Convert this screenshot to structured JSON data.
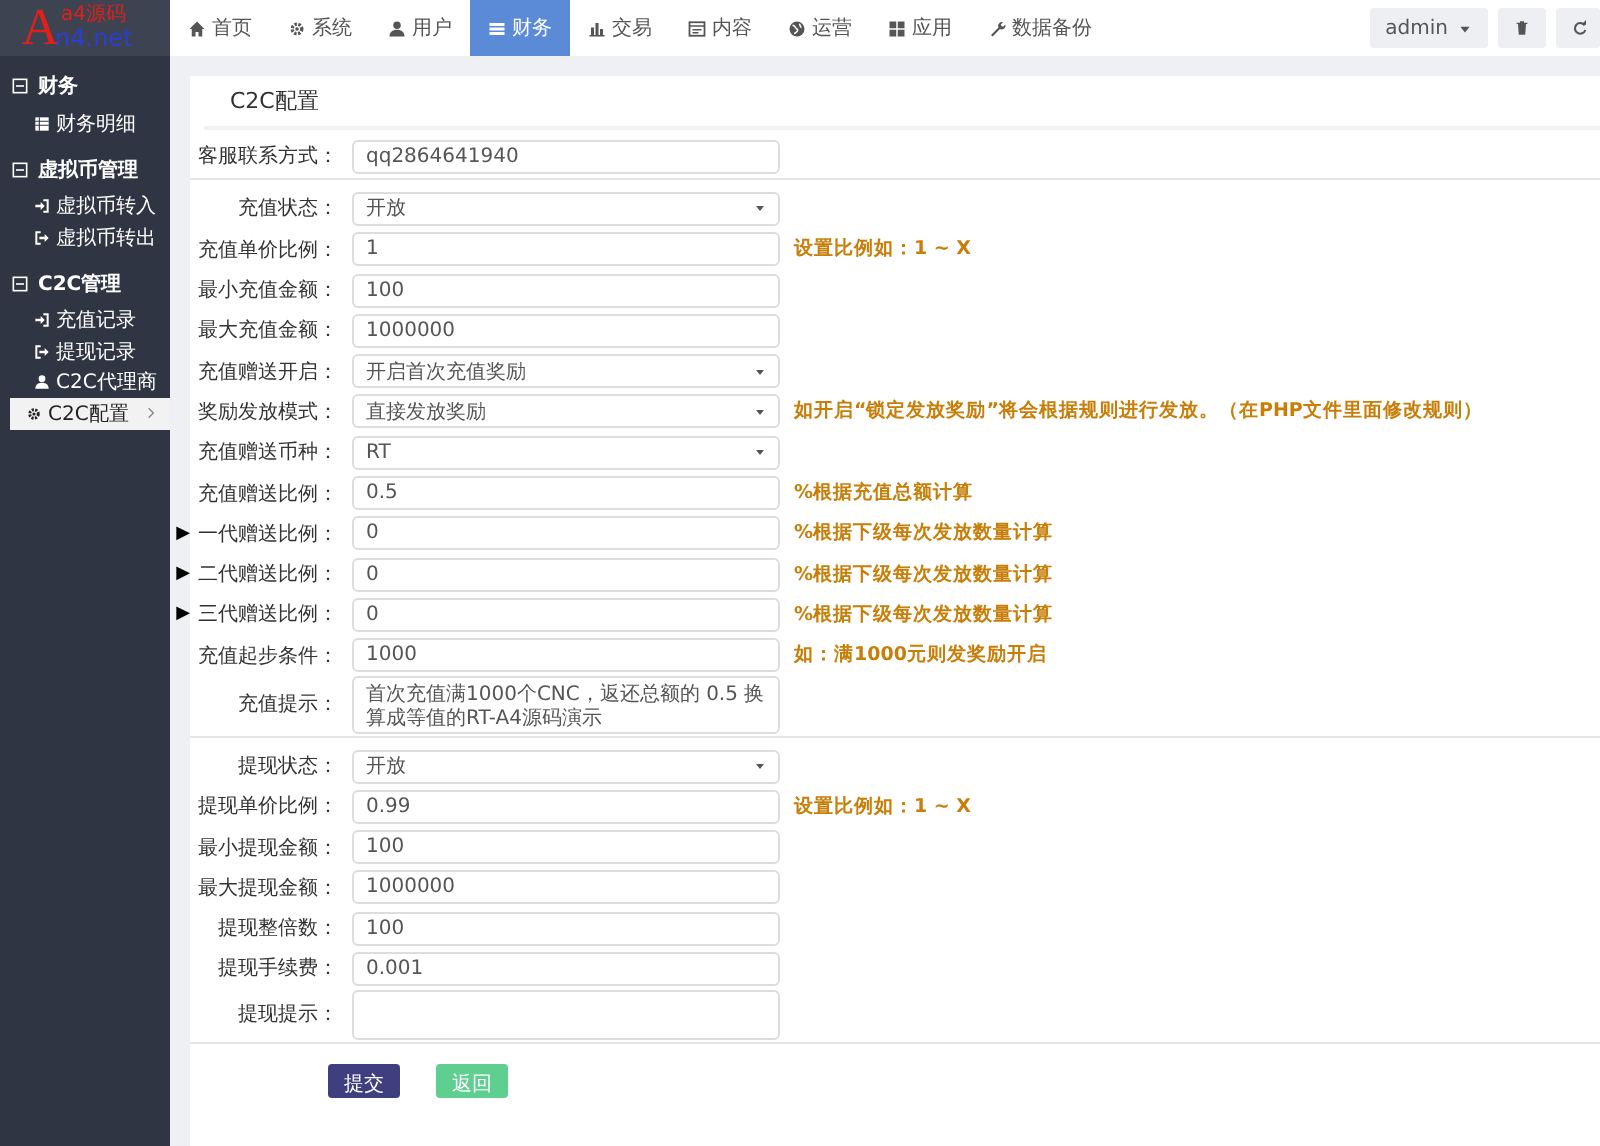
{
  "logo": {
    "big": "A",
    "top": "a4源码",
    "bottom": "n4.net"
  },
  "sidebar": {
    "groups": [
      {
        "title": "财务",
        "items": [
          {
            "label": "财务明细",
            "selected": false
          }
        ]
      },
      {
        "title": "虚拟币管理",
        "items": [
          {
            "label": "虚拟币转入",
            "selected": false
          },
          {
            "label": "虚拟币转出",
            "selected": false
          }
        ]
      },
      {
        "title": "C2C管理",
        "items": [
          {
            "label": "充值记录",
            "selected": false
          },
          {
            "label": "提现记录",
            "selected": false
          },
          {
            "label": "C2C代理商",
            "selected": false
          },
          {
            "label": "C2C配置",
            "selected": true
          }
        ]
      }
    ]
  },
  "nav": {
    "items": [
      {
        "label": "首页",
        "selected": false
      },
      {
        "label": "系统",
        "selected": false
      },
      {
        "label": "用户",
        "selected": false
      },
      {
        "label": "财务",
        "selected": true
      },
      {
        "label": "交易",
        "selected": false
      },
      {
        "label": "内容",
        "selected": false
      },
      {
        "label": "运营",
        "selected": false
      },
      {
        "label": "应用",
        "selected": false
      },
      {
        "label": "数据备份",
        "selected": false
      }
    ],
    "user": "admin"
  },
  "card": {
    "title": "C2C配置",
    "sections": [
      [
        {
          "label": "客服联系方式：",
          "kind": "input",
          "value": "qq2864641940"
        }
      ],
      [
        {
          "label": "充值状态：",
          "kind": "select",
          "value": "开放"
        },
        {
          "label": "充值单价比例：",
          "kind": "input",
          "value": "1",
          "hint": "设置比例如：1 ~ X"
        },
        {
          "label": "最小充值金额：",
          "kind": "input",
          "value": "100"
        },
        {
          "label": "最大充值金额：",
          "kind": "input",
          "value": "1000000"
        },
        {
          "label": "充值赠送开启：",
          "kind": "select",
          "value": "开启首次充值奖励"
        },
        {
          "label": "奖励发放模式：",
          "kind": "select",
          "value": "直接发放奖励",
          "hint": "如开启“锁定发放奖励”将会根据规则进行发放。（在PHP文件里面修改规则）"
        },
        {
          "label": "充值赠送币种：",
          "kind": "select",
          "value": "RT"
        },
        {
          "label": "充值赠送比例：",
          "kind": "input",
          "value": "0.5",
          "hint": "%根据充值总额计算"
        },
        {
          "marker": "▶",
          "label": "一代赠送比例：",
          "kind": "input",
          "value": "0",
          "hint": "%根据下级每次发放数量计算"
        },
        {
          "marker": "▶",
          "label": "二代赠送比例：",
          "kind": "input",
          "value": "0",
          "hint": "%根据下级每次发放数量计算"
        },
        {
          "marker": "▶",
          "label": "三代赠送比例：",
          "kind": "input",
          "value": "0",
          "hint": "%根据下级每次发放数量计算"
        },
        {
          "label": "充值起步条件：",
          "kind": "input",
          "value": "1000",
          "hint": "如：满1000元则发奖励开启"
        },
        {
          "label": "充值提示：",
          "kind": "textarea",
          "value": "首次充值满1000个CNC，返还总额的 0.5 换算成等值的RT-A4源码演示"
        }
      ],
      [
        {
          "label": "提现状态：",
          "kind": "select",
          "value": "开放"
        },
        {
          "label": "提现单价比例：",
          "kind": "input",
          "value": "0.99",
          "hint": "设置比例如：1 ~ X"
        },
        {
          "label": "最小提现金额：",
          "kind": "input",
          "value": "100"
        },
        {
          "label": "最大提现金额：",
          "kind": "input",
          "value": "1000000"
        },
        {
          "label": "提现整倍数：",
          "kind": "input",
          "value": "100"
        },
        {
          "label": "提现手续费：",
          "kind": "input",
          "value": "0.001"
        },
        {
          "label": "提现提示：",
          "kind": "textarea"
        }
      ]
    ],
    "buttons": [
      {
        "label": "提交",
        "kind": "primary"
      },
      {
        "label": "返回",
        "kind": "success"
      }
    ]
  }
}
